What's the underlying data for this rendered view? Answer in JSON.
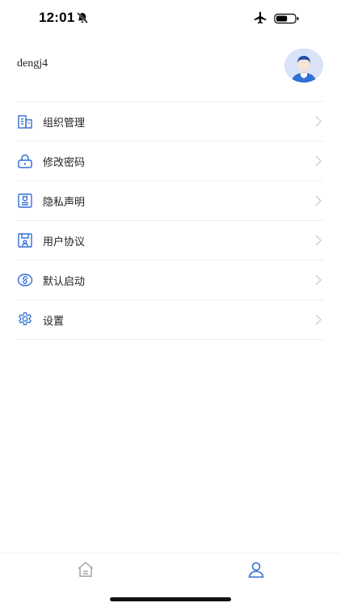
{
  "status_bar": {
    "time": "12:01",
    "icons": [
      "bell-slash-icon",
      "airplane-icon",
      "battery-icon"
    ],
    "battery_level": 0.6
  },
  "profile": {
    "username": "dengj4",
    "avatar_icon": "user-avatar-icon"
  },
  "menu": {
    "items": [
      {
        "label": "组织管理",
        "icon": "building-icon"
      },
      {
        "label": "修改密码",
        "icon": "lock-icon"
      },
      {
        "label": "隐私声明",
        "icon": "privacy-document-icon"
      },
      {
        "label": "用户协议",
        "icon": "agreement-icon"
      },
      {
        "label": "默认启动",
        "icon": "launch-icon"
      },
      {
        "label": "设置",
        "icon": "gear-icon"
      }
    ]
  },
  "tab_bar": {
    "tabs": [
      {
        "icon": "home-icon",
        "active": false
      },
      {
        "icon": "user-icon",
        "active": true
      }
    ]
  },
  "colors": {
    "accent": "#2f6fd6",
    "icon_inactive": "#9aa0a6",
    "divider": "#efefef",
    "avatar_bg": "#d9e2f8"
  }
}
